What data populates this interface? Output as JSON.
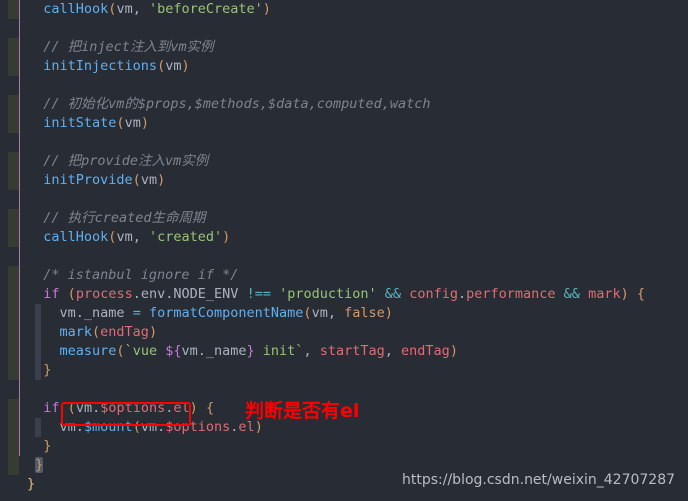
{
  "editor": {
    "theme_name": "one-dark",
    "background": "#282c34",
    "default_text_color": "#abb2bf",
    "diff_marker_color": "#373c33",
    "indent_guide_color": "#c586c0",
    "selection_color": "#3a3f4b",
    "bracket_highlight_color": "#515a6b"
  },
  "code_lines": [
    {
      "indent": "  ",
      "tokens": [
        {
          "t": "callHook",
          "c": "fn"
        },
        {
          "t": "(",
          "c": "paren"
        },
        {
          "t": "vm",
          "c": "plain"
        },
        {
          "t": ",",
          "c": "punc"
        },
        {
          "t": " ",
          "c": "plain"
        },
        {
          "t": "'beforeCreate'",
          "c": "str"
        },
        {
          "t": ")",
          "c": "paren"
        }
      ]
    },
    {
      "indent": "  ",
      "tokens": []
    },
    {
      "indent": "  ",
      "tokens": [
        {
          "t": "// 把inject注入到vm实例",
          "c": "cmt"
        }
      ]
    },
    {
      "indent": "  ",
      "tokens": [
        {
          "t": "initInjections",
          "c": "fn"
        },
        {
          "t": "(",
          "c": "paren"
        },
        {
          "t": "vm",
          "c": "plain"
        },
        {
          "t": ")",
          "c": "paren"
        }
      ]
    },
    {
      "indent": "  ",
      "tokens": []
    },
    {
      "indent": "  ",
      "tokens": [
        {
          "t": "// 初始化vm的$props,$methods,$data,computed,watch",
          "c": "cmt"
        }
      ]
    },
    {
      "indent": "  ",
      "tokens": [
        {
          "t": "initState",
          "c": "fn"
        },
        {
          "t": "(",
          "c": "paren"
        },
        {
          "t": "vm",
          "c": "plain"
        },
        {
          "t": ")",
          "c": "paren"
        }
      ]
    },
    {
      "indent": "  ",
      "tokens": []
    },
    {
      "indent": "  ",
      "tokens": [
        {
          "t": "// 把provide注入vm实例",
          "c": "cmt"
        }
      ]
    },
    {
      "indent": "  ",
      "tokens": [
        {
          "t": "initProvide",
          "c": "fn"
        },
        {
          "t": "(",
          "c": "paren"
        },
        {
          "t": "vm",
          "c": "plain"
        },
        {
          "t": ")",
          "c": "paren"
        }
      ]
    },
    {
      "indent": "  ",
      "tokens": []
    },
    {
      "indent": "  ",
      "tokens": [
        {
          "t": "// 执行created生命周期",
          "c": "cmt"
        }
      ]
    },
    {
      "indent": "  ",
      "tokens": [
        {
          "t": "callHook",
          "c": "fn"
        },
        {
          "t": "(",
          "c": "paren"
        },
        {
          "t": "vm",
          "c": "plain"
        },
        {
          "t": ",",
          "c": "punc"
        },
        {
          "t": " ",
          "c": "plain"
        },
        {
          "t": "'created'",
          "c": "str"
        },
        {
          "t": ")",
          "c": "paren"
        }
      ]
    },
    {
      "indent": "  ",
      "tokens": []
    },
    {
      "indent": "  ",
      "tokens": [
        {
          "t": "/* istanbul ignore if */",
          "c": "cmt"
        }
      ]
    },
    {
      "indent": "  ",
      "tokens": [
        {
          "t": "if",
          "c": "kw"
        },
        {
          "t": " ",
          "c": "plain"
        },
        {
          "t": "(",
          "c": "paren"
        },
        {
          "t": "process",
          "c": "ctl"
        },
        {
          "t": ".",
          "c": "plain"
        },
        {
          "t": "env",
          "c": "plain"
        },
        {
          "t": ".",
          "c": "plain"
        },
        {
          "t": "NODE_ENV",
          "c": "plain"
        },
        {
          "t": " ",
          "c": "plain"
        },
        {
          "t": "!==",
          "c": "op"
        },
        {
          "t": " ",
          "c": "plain"
        },
        {
          "t": "'production'",
          "c": "str"
        },
        {
          "t": " ",
          "c": "plain"
        },
        {
          "t": "&&",
          "c": "op"
        },
        {
          "t": " ",
          "c": "plain"
        },
        {
          "t": "config",
          "c": "ctl"
        },
        {
          "t": ".",
          "c": "plain"
        },
        {
          "t": "performance",
          "c": "ctl"
        },
        {
          "t": " ",
          "c": "plain"
        },
        {
          "t": "&&",
          "c": "op"
        },
        {
          "t": " ",
          "c": "plain"
        },
        {
          "t": "mark",
          "c": "ctl"
        },
        {
          "t": ")",
          "c": "paren"
        },
        {
          "t": " ",
          "c": "plain"
        },
        {
          "t": "{",
          "c": "brace"
        }
      ]
    },
    {
      "indent": "    ",
      "tokens": [
        {
          "t": "vm",
          "c": "plain"
        },
        {
          "t": ".",
          "c": "plain"
        },
        {
          "t": "_name",
          "c": "plain"
        },
        {
          "t": " ",
          "c": "plain"
        },
        {
          "t": "=",
          "c": "op"
        },
        {
          "t": " ",
          "c": "plain"
        },
        {
          "t": "formatComponentName",
          "c": "fn"
        },
        {
          "t": "(",
          "c": "paren"
        },
        {
          "t": "vm",
          "c": "plain"
        },
        {
          "t": ",",
          "c": "punc"
        },
        {
          "t": " ",
          "c": "plain"
        },
        {
          "t": "false",
          "c": "num"
        },
        {
          "t": ")",
          "c": "paren"
        }
      ]
    },
    {
      "indent": "    ",
      "tokens": [
        {
          "t": "mark",
          "c": "fn"
        },
        {
          "t": "(",
          "c": "paren"
        },
        {
          "t": "endTag",
          "c": "ctl"
        },
        {
          "t": ")",
          "c": "paren"
        }
      ]
    },
    {
      "indent": "    ",
      "tokens": [
        {
          "t": "measure",
          "c": "fn"
        },
        {
          "t": "(",
          "c": "paren"
        },
        {
          "t": "`vue ",
          "c": "str"
        },
        {
          "t": "${",
          "c": "paren2"
        },
        {
          "t": "vm",
          "c": "plain"
        },
        {
          "t": ".",
          "c": "plain"
        },
        {
          "t": "_name",
          "c": "plain"
        },
        {
          "t": "}",
          "c": "paren2"
        },
        {
          "t": " init`",
          "c": "str"
        },
        {
          "t": ",",
          "c": "punc"
        },
        {
          "t": " ",
          "c": "plain"
        },
        {
          "t": "startTag",
          "c": "ctl"
        },
        {
          "t": ",",
          "c": "punc"
        },
        {
          "t": " ",
          "c": "plain"
        },
        {
          "t": "endTag",
          "c": "ctl"
        },
        {
          "t": ")",
          "c": "paren"
        }
      ]
    },
    {
      "indent": "  ",
      "tokens": [
        {
          "t": "}",
          "c": "brace"
        }
      ]
    },
    {
      "indent": "  ",
      "tokens": []
    },
    {
      "indent": "  ",
      "tokens": [
        {
          "t": "if",
          "c": "kw"
        },
        {
          "t": " ",
          "c": "plain"
        },
        {
          "t": "(",
          "c": "paren"
        },
        {
          "t": "vm",
          "c": "plain"
        },
        {
          "t": ".",
          "c": "plain"
        },
        {
          "t": "$options",
          "c": "ctl"
        },
        {
          "t": ".",
          "c": "plain"
        },
        {
          "t": "el",
          "c": "ctl"
        },
        {
          "t": ")",
          "c": "paren"
        },
        {
          "t": " ",
          "c": "plain"
        },
        {
          "t": "{",
          "c": "brace"
        }
      ]
    },
    {
      "indent": "    ",
      "tokens": [
        {
          "t": "vm",
          "c": "plain"
        },
        {
          "t": ".",
          "c": "plain"
        },
        {
          "t": "$mount",
          "c": "fn"
        },
        {
          "t": "(",
          "c": "paren"
        },
        {
          "t": "vm",
          "c": "plain"
        },
        {
          "t": ".",
          "c": "plain"
        },
        {
          "t": "$options",
          "c": "ctl"
        },
        {
          "t": ".",
          "c": "plain"
        },
        {
          "t": "el",
          "c": "ctl"
        },
        {
          "t": ")",
          "c": "paren"
        }
      ]
    },
    {
      "indent": "  ",
      "tokens": [
        {
          "t": "}",
          "c": "brace"
        }
      ]
    },
    {
      "indent": " ",
      "tokens": [
        {
          "t": "}",
          "c": "brace",
          "hl": true
        }
      ]
    },
    {
      "indent": "",
      "tokens": [
        {
          "t": "}",
          "c": "iden"
        }
      ]
    }
  ],
  "annotation": {
    "note_text": "判断是否有el",
    "note_color": "#fe0000",
    "box_color": "#fe0000",
    "box_target_text": "(vm.$options.el)"
  },
  "watermark": {
    "text": "https://blog.csdn.net/weixin_42707287",
    "color": "#b9bcc2"
  }
}
